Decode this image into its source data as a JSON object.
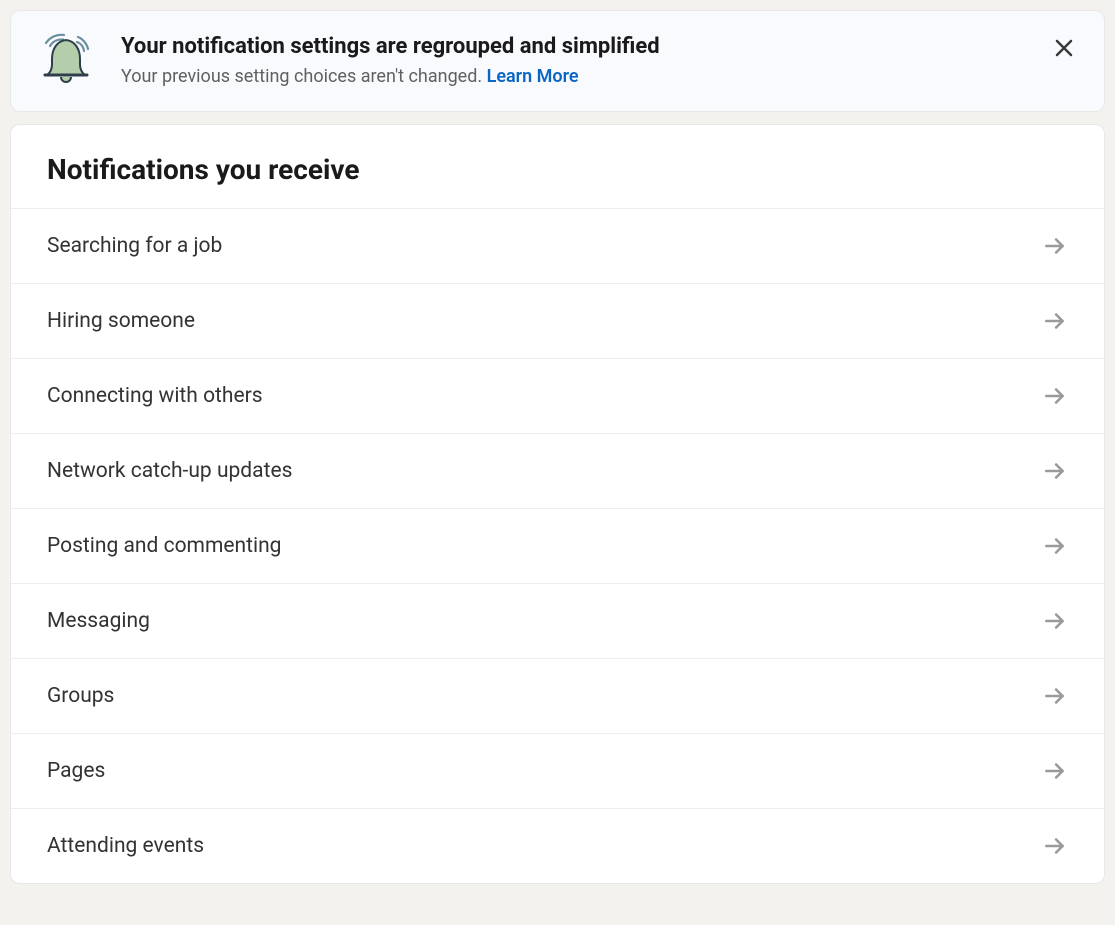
{
  "banner": {
    "title": "Your notification settings are regrouped and simplified",
    "subtext": "Your previous setting choices aren't changed. ",
    "learn_more": "Learn More"
  },
  "card": {
    "title": "Notifications you receive",
    "rows": [
      "Searching for a job",
      "Hiring someone",
      "Connecting with others",
      "Network catch-up updates",
      "Posting and commenting",
      "Messaging",
      "Groups",
      "Pages",
      "Attending events"
    ]
  }
}
